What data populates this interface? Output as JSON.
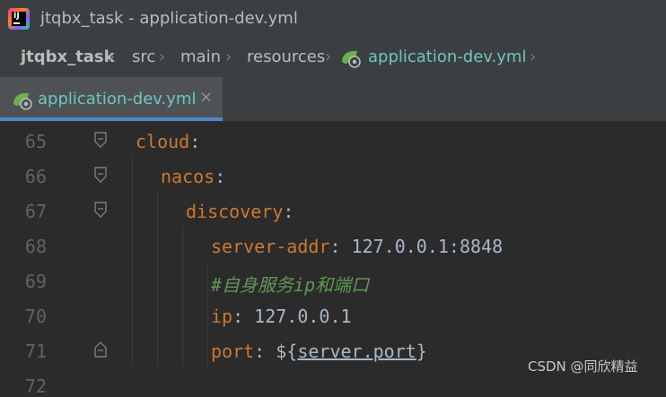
{
  "window": {
    "title": "jtqbx_task - application-dev.yml"
  },
  "breadcrumbs": [
    {
      "label": "jtqbx_task"
    },
    {
      "label": "src"
    },
    {
      "label": "main"
    },
    {
      "label": "resources"
    },
    {
      "label": "application-dev.yml"
    }
  ],
  "tabs": [
    {
      "label": "application-dev.yml",
      "close": "×",
      "icon": "spring-leaf-yaml-icon"
    }
  ],
  "editor": {
    "lines": [
      {
        "num": "65",
        "key": "cloud",
        "colon": ":"
      },
      {
        "num": "66",
        "key": "nacos",
        "colon": ":"
      },
      {
        "num": "67",
        "key": "discovery",
        "colon": ":"
      },
      {
        "num": "68",
        "key": "server-addr",
        "colon": ":",
        "value": " 127.0.0.1:8848"
      },
      {
        "num": "69",
        "comment": "#自身服务ip和端口"
      },
      {
        "num": "70",
        "key": "ip",
        "colon": ":",
        "value": " 127.0.0.1"
      },
      {
        "num": "71",
        "key": "port",
        "colon": ":",
        "value_prefix": " ${",
        "value_ref": "server.port",
        "value_suffix": "}"
      },
      {
        "num": "72"
      }
    ]
  },
  "watermark": "CSDN @同欣精益",
  "colors": {
    "key": "#cc7832",
    "comment": "#629755",
    "file_accent": "#6fc6c0",
    "tab_underline": "#4a88c7"
  }
}
